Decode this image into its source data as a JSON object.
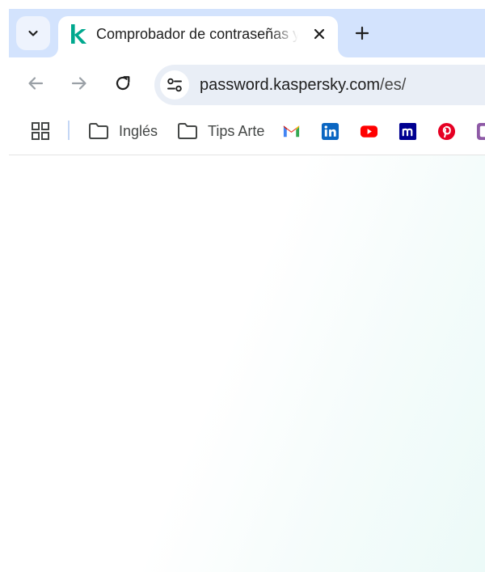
{
  "tab": {
    "title": "Comprobador de contraseñas y",
    "favicon": "kaspersky-k-icon",
    "favicon_color": "#00a88e"
  },
  "toolbar": {
    "url_domain": "password.kaspersky.com",
    "url_path": "/es/"
  },
  "bookmarks": {
    "folders": [
      {
        "label": "Inglés"
      },
      {
        "label": "Tips Arte"
      }
    ],
    "sites": [
      {
        "name": "gmail-icon"
      },
      {
        "name": "linkedin-icon"
      },
      {
        "name": "youtube-icon"
      },
      {
        "name": "meetup-icon"
      },
      {
        "name": "pinterest-icon"
      },
      {
        "name": "bookmark-partial-icon"
      }
    ]
  },
  "colors": {
    "tabstrip": "#d3e3fd",
    "omnibox": "#e9eef6",
    "page_tint": "#ecfaf8"
  }
}
